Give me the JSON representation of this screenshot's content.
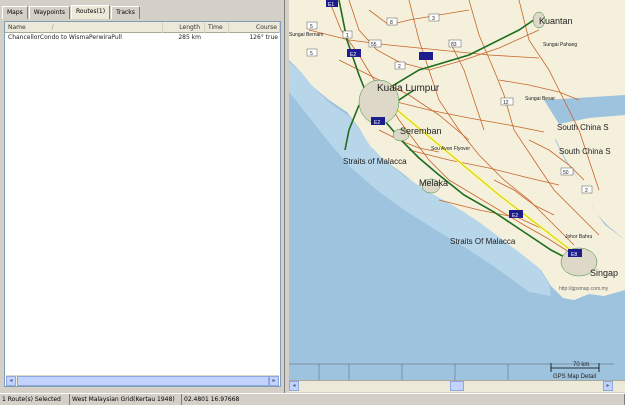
{
  "tabs": [
    {
      "label": "Maps",
      "active": false
    },
    {
      "label": "Waypoints",
      "active": false
    },
    {
      "label": "Routes(1)",
      "active": true
    },
    {
      "label": "Tracks",
      "active": false
    }
  ],
  "columns": {
    "name": "Name",
    "sort_indicator": "/",
    "length": "Length",
    "time": "Time",
    "course": "Course"
  },
  "rows": [
    {
      "name": "ChancellorCondo to WismaPerwiraPull",
      "length": "285 km",
      "time": "",
      "course": "126° true"
    }
  ],
  "map": {
    "labels": {
      "kuantan": "Kuantan",
      "kuala_lumpur": "Kuala Lumpur",
      "seremban": "Seremban",
      "straits_malacca_1": "Straits of Malacca",
      "straits_malacca_2": "Straits Of Malacca",
      "melaka": "Melaka",
      "south_china_sea_1": "South China S",
      "south_china_sea_2": "South China S",
      "singapore": "Singap",
      "flyover": "Sou Avon Flyover",
      "sungai_pahang": "Sungai Pahang",
      "sungai_besar": "Sungai Besar",
      "sungai_bernam": "Sungai Bernam",
      "johor_bahru": "Johor Bahru",
      "watermark": "http://gpsmap.com.my",
      "scale": "70 km",
      "gps_detail": "GPS Map Detail"
    },
    "route_shields": [
      "E1",
      "E2",
      "E2",
      "E2",
      "E8"
    ],
    "road_numbers": [
      "1",
      "5",
      "8",
      "55",
      "83",
      "2",
      "3",
      "12",
      "50",
      "5",
      "2"
    ]
  },
  "status": {
    "selection": "1 Route(s) Selected",
    "datum": "West Malaysian Grid(Kertau 1948)",
    "position": "02.4801 16.97668"
  },
  "colors": {
    "water": "#9ec3df",
    "land": "#f4f0dc",
    "route": "#ffff88",
    "highway": "#1d6d1d",
    "road": "#c8662a"
  }
}
